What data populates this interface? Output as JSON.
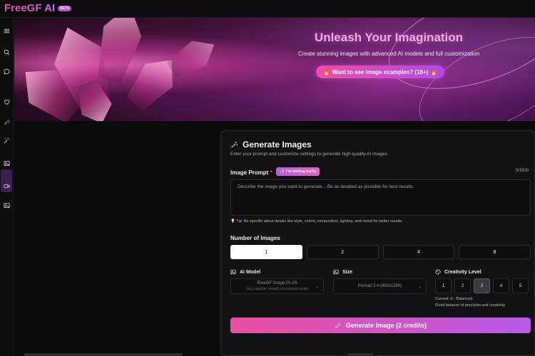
{
  "header": {
    "brand": "FreeGF AI",
    "badge": "BETA"
  },
  "sidebar": {
    "items": [
      {
        "name": "menu-icon"
      },
      {
        "name": "search-icon"
      },
      {
        "name": "chat-icon"
      },
      {
        "name": "heart-icon"
      },
      {
        "name": "wand-icon"
      },
      {
        "name": "magic-wand-icon"
      },
      {
        "name": "image-icon",
        "active": true
      },
      {
        "name": "video-icon"
      },
      {
        "name": "gallery-icon"
      }
    ]
  },
  "banner": {
    "title": "Unleash Your Imagination",
    "subtitle": "Create stunning images with advanced AI models and full customization",
    "cta_label": "Want to see image examples? (18+)"
  },
  "card": {
    "title": "Generate Images",
    "description": "Enter your prompt and customize settings to generate high-quality AI images",
    "prompt_label": "Image Prompt",
    "required_mark": "*",
    "lucky_label": "I'm feeling lucky",
    "counter": "0/1500",
    "prompt_placeholder": "Describe the image you want to generate... Be as detailed as possible for best results.",
    "tip": "Tip: Be specific about details like style, colors, composition, lighting, and mood for better results.",
    "num_images_label": "Number of Images",
    "num_options": [
      "1",
      "2",
      "4",
      "8"
    ],
    "num_selected": "1",
    "ai_model_label": "AI Model",
    "ai_model_value": "FreeGF Image PLUS",
    "ai_model_desc": "Very capable overall uncensored model",
    "size_label": "Size",
    "size_value": "Portrait 3:4 (960x1280)",
    "creativity_label": "Creativity Level",
    "creativity_options": [
      "1",
      "2",
      "3",
      "4",
      "5"
    ],
    "creativity_selected": "3",
    "creativity_current": "Current: 3 - Balanced",
    "creativity_desc": "Good balance of precision and creativity",
    "generate_label": "Generate Image (2 credits)"
  },
  "colors": {
    "accent_pink": "#e9509f",
    "accent_purple": "#b95ae9"
  }
}
